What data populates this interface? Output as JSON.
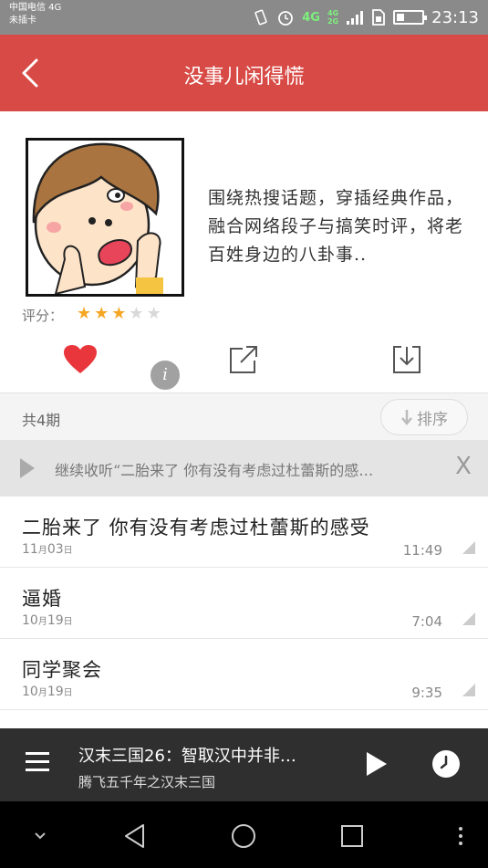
{
  "status_bar": {
    "carrier_line1": "中国电信 4G",
    "carrier_line2": "未插卡",
    "network_main": "4G",
    "network_small_top": "4G",
    "network_small_bottom": "2G",
    "time": "23:13"
  },
  "header": {
    "title": "没事儿闲得慌",
    "background_color": "#d84a45"
  },
  "album": {
    "description": "围绕热搜话题，穿插经典作品，融合网络段子与搞笑时评，将老百姓身边的八卦事..",
    "rating_label": "评分：",
    "rating": 3,
    "rating_max": 5,
    "info_icon_glyph": "i",
    "actions": [
      "heart-icon",
      "share-icon",
      "download-icon"
    ]
  },
  "list_header": {
    "episode_count": "共4期",
    "sort_label": "排序"
  },
  "resume": {
    "text": "继续收听“二胎来了 你有没有考虑过杜蕾斯的感…",
    "close_glyph": "X"
  },
  "episodes": [
    {
      "title": "二胎来了 你有没有考虑过杜蕾斯的感受",
      "date_month": "11",
      "date_day": "03",
      "duration": "11:49"
    },
    {
      "title": "逼婚",
      "date_month": "10",
      "date_day": "19",
      "duration": "7:04"
    },
    {
      "title": "同学聚会",
      "date_month": "10",
      "date_day": "19",
      "duration": "9:35"
    }
  ],
  "date_units": {
    "month": "月",
    "day": "日"
  },
  "player": {
    "title_prefix": "汉末三国",
    "title_number": "26",
    "title_suffix": "：智取汉中并非…",
    "subtitle": "腾飞五千年之汉末三国"
  },
  "colors": {
    "accent_red": "#d84a45",
    "star_on": "#f5a623",
    "heart": "#e8363c"
  }
}
